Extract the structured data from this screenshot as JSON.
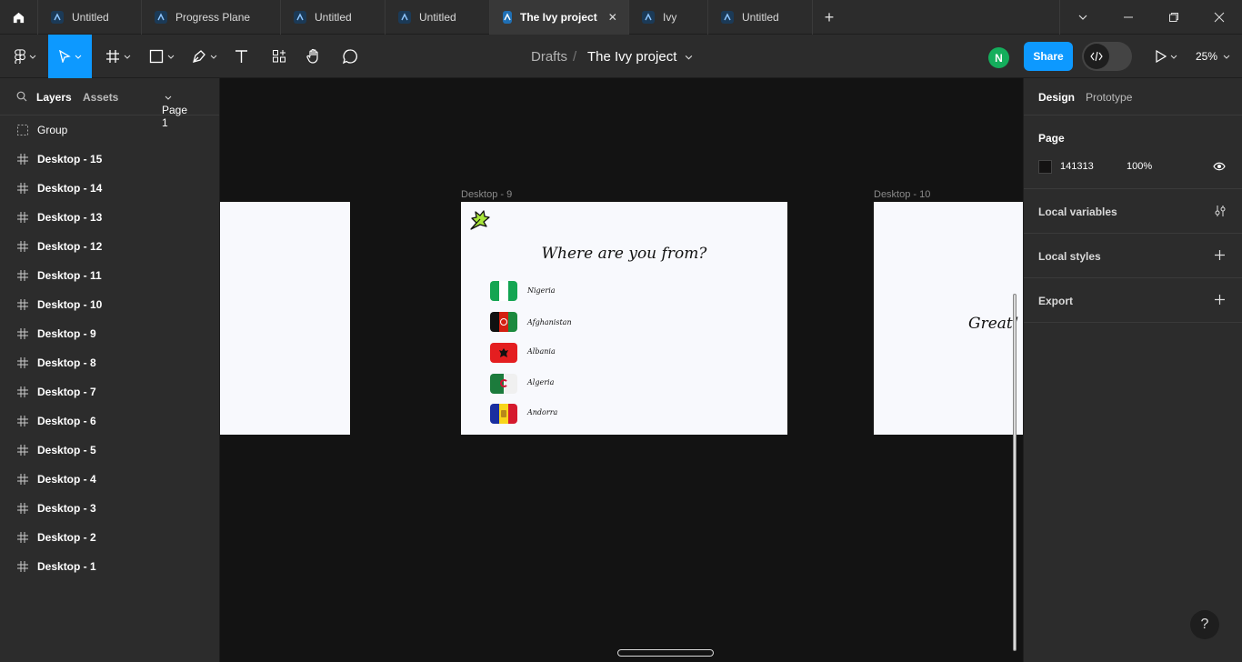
{
  "tabs": [
    {
      "label": "Untitled",
      "active": false
    },
    {
      "label": "Progress Plane",
      "active": false
    },
    {
      "label": "Untitled",
      "active": false
    },
    {
      "label": "Untitled",
      "active": false
    },
    {
      "label": "The Ivy project",
      "active": true
    },
    {
      "label": "Ivy",
      "active": false
    },
    {
      "label": "Untitled",
      "active": false
    }
  ],
  "toolbar": {
    "breadcrumb_parent": "Drafts",
    "breadcrumb_sep": "/",
    "project_title": "The Ivy project",
    "avatar_initial": "N",
    "share_label": "Share",
    "zoom": "25%"
  },
  "left_panel": {
    "tab_layers": "Layers",
    "tab_assets": "Assets",
    "page_selector": "Page 1",
    "layers": [
      "Group",
      "Desktop - 15",
      "Desktop - 14",
      "Desktop - 13",
      "Desktop - 12",
      "Desktop - 11",
      "Desktop - 10",
      "Desktop - 9",
      "Desktop - 8",
      "Desktop - 7",
      "Desktop - 6",
      "Desktop - 5",
      "Desktop - 4",
      "Desktop - 3",
      "Desktop - 2",
      "Desktop - 1"
    ]
  },
  "canvas": {
    "frame9_label": "Desktop - 9",
    "frame10_label": "Desktop - 10",
    "frame9_title": "Where are you from?",
    "countries": [
      "Nigeria",
      "Afghanistan",
      "Albania",
      "Algeria",
      "Andorra"
    ],
    "frame10_text": "Great! We"
  },
  "right_panel": {
    "tab_design": "Design",
    "tab_prototype": "Prototype",
    "page_title": "Page",
    "page_color": "141313",
    "page_opacity": "100%",
    "local_variables": "Local variables",
    "local_styles": "Local styles",
    "export": "Export"
  },
  "help": "?",
  "colors": {
    "accent": "#0d99ff",
    "avatar": "#14ae5c",
    "canvas": "#131313",
    "panel": "#2c2c2c"
  }
}
